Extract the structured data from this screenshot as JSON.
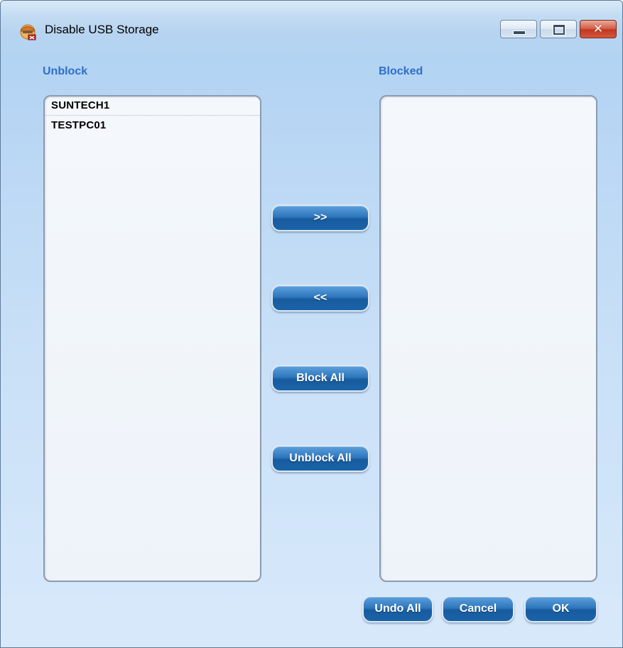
{
  "window": {
    "title": "Disable USB Storage",
    "icon": "usb-user-icon"
  },
  "unblock": {
    "label": "Unblock",
    "items": [
      "SUNTECH1",
      "TESTPC01"
    ]
  },
  "blocked": {
    "label": "Blocked",
    "items": []
  },
  "middle_buttons": {
    "move_right": ">>",
    "move_left": "<<",
    "block_all": "Block All",
    "unblock_all": "Unblock All"
  },
  "footer_buttons": {
    "undo_all": "Undo All",
    "cancel": "Cancel",
    "ok": "OK"
  },
  "colors": {
    "label_blue": "#2d6fc9",
    "button_blue": "#1a63a8",
    "background": "#c9e0f7"
  }
}
